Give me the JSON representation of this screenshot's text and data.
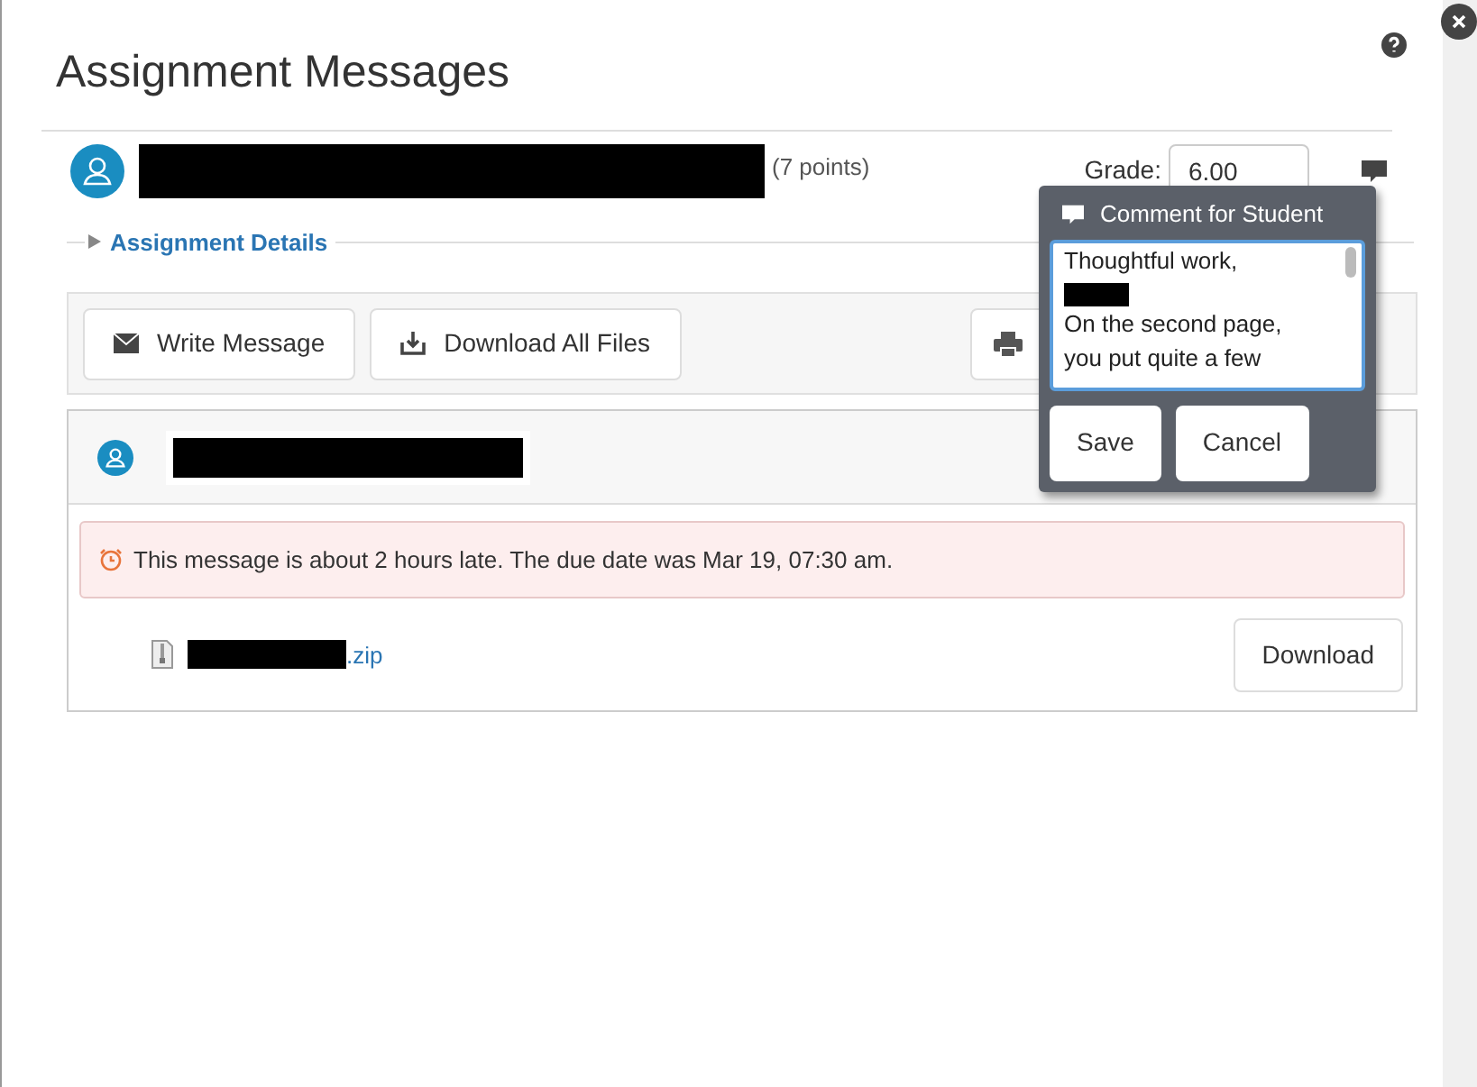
{
  "dialog": {
    "title": "Assignment Messages"
  },
  "student": {
    "points": "(7 points)",
    "grade_label": "Grade:",
    "grade_value": "6.00"
  },
  "details_link": "Assignment Details",
  "toolbar": [
    {
      "label": "Write Message",
      "kind": "envelope"
    },
    {
      "label": "Download All Files",
      "kind": "download"
    }
  ],
  "message": {
    "late_notice": "This message is about 2 hours late. The due date was Mar 19, 07:30 am.",
    "file_ext": ".zip",
    "download": "Download"
  },
  "comment_popover": {
    "title": "Comment for Student",
    "text_before": "Thoughtful work,",
    "text_after": "On the second page, you put quite a few",
    "buttons": [
      "Save",
      "Cancel"
    ]
  }
}
